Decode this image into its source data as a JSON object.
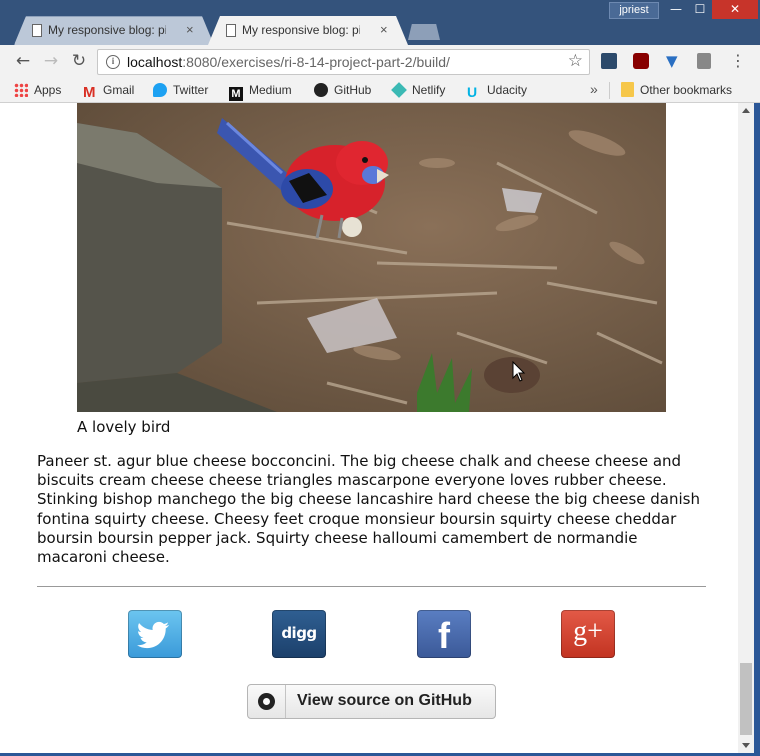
{
  "window": {
    "user": "jpriest",
    "minimize_glyph": "—",
    "maximize_glyph": "☐",
    "close_glyph": "✕"
  },
  "tabs": [
    {
      "title": "My responsive blog: pictu",
      "close": "×",
      "active": false
    },
    {
      "title": "My responsive blog: pictu",
      "close": "×",
      "active": true
    }
  ],
  "toolbar": {
    "back": "←",
    "forward": "→",
    "reload": "↻",
    "url_host": "localhost",
    "url_rest": ":8080/exercises/ri-8-14-project-part-2/build/",
    "info": "i",
    "star": "☆",
    "menu": "⋮"
  },
  "bookmarks": {
    "items": [
      {
        "label": "Apps",
        "icon": "apps-grid-icon"
      },
      {
        "label": "Gmail",
        "icon": "gmail-icon"
      },
      {
        "label": "Twitter",
        "icon": "twitter-icon"
      },
      {
        "label": "Medium",
        "icon": "medium-icon"
      },
      {
        "label": "GitHub",
        "icon": "github-icon"
      },
      {
        "label": "Netlify",
        "icon": "netlify-icon"
      },
      {
        "label": "Udacity",
        "icon": "udacity-icon"
      }
    ],
    "more": "»",
    "other": "Other bookmarks"
  },
  "page": {
    "caption": "A lovely bird",
    "paragraph": "Paneer st. agur blue cheese bocconcini. The big cheese chalk and cheese cheese and biscuits cream cheese cheese triangles mascarpone everyone loves rubber cheese. Stinking bishop manchego the big cheese lancashire hard cheese the big cheese danish fontina squirty cheese. Cheesy feet croque monsieur boursin squirty cheese cheddar boursin boursin pepper jack. Squirty cheese halloumi camembert de normandie macaroni cheese.",
    "social": [
      {
        "name": "Twitter",
        "glyph": ""
      },
      {
        "name": "Digg",
        "glyph": "digg"
      },
      {
        "name": "Facebook",
        "glyph": "f"
      },
      {
        "name": "Google+",
        "glyph": "g+"
      }
    ],
    "github_button": "View source on GitHub"
  }
}
